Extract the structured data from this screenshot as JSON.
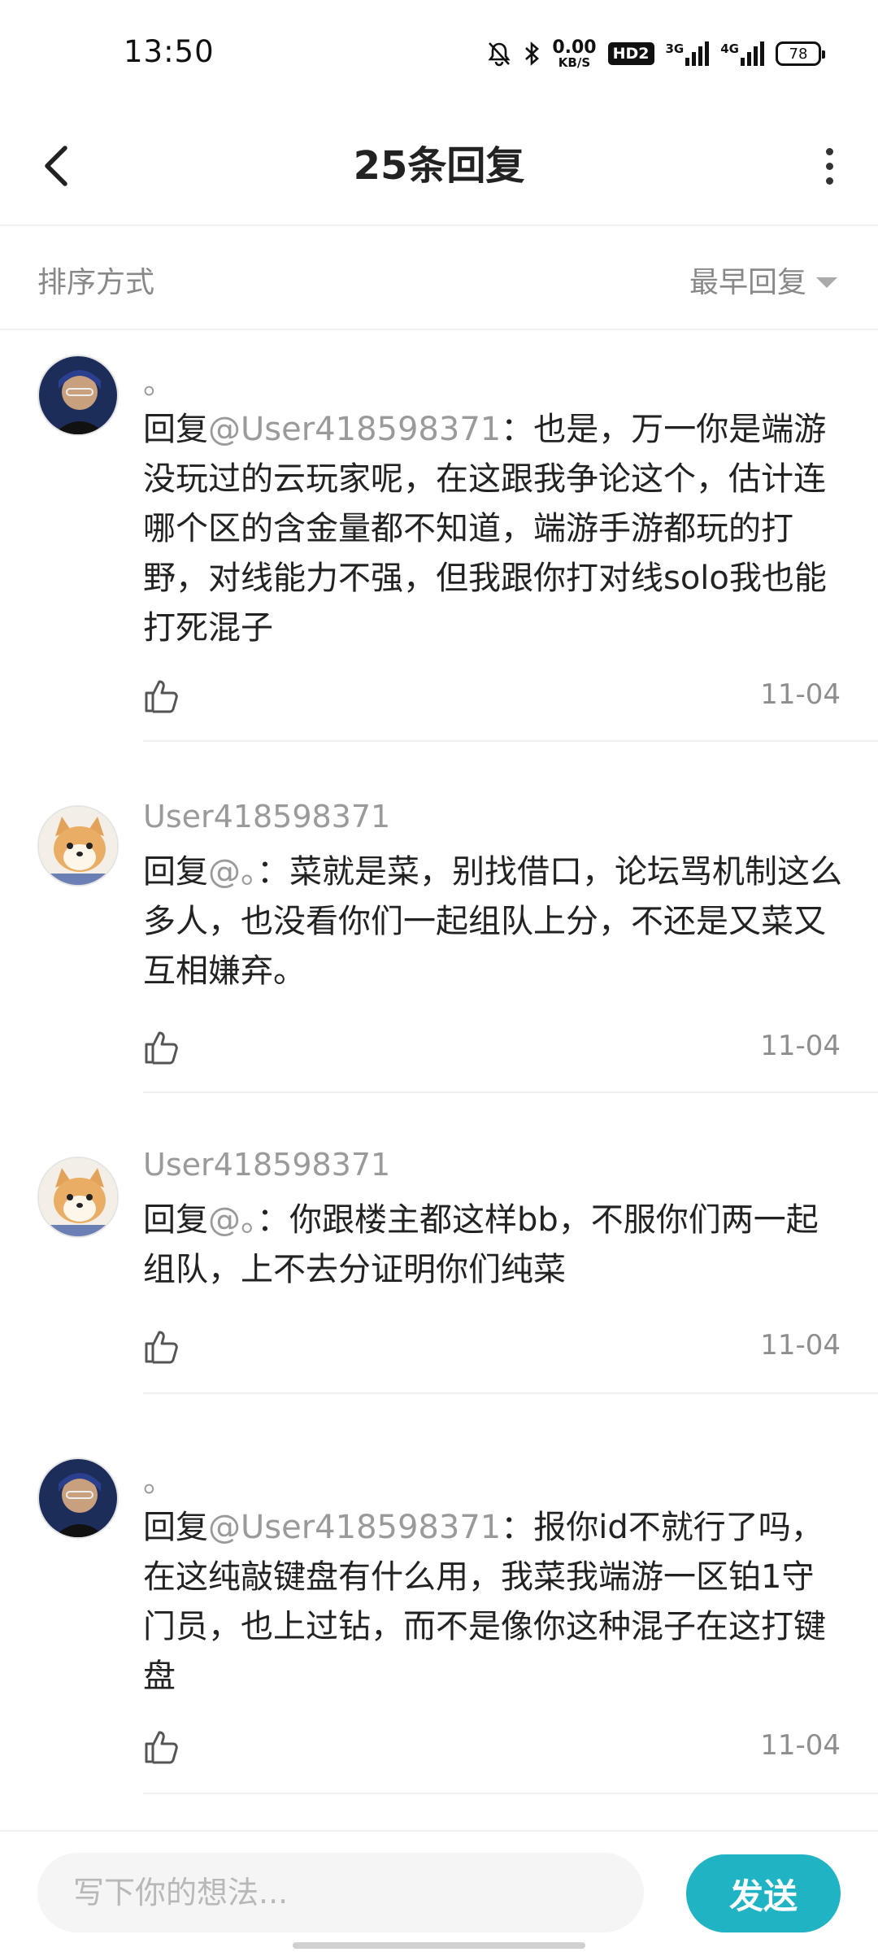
{
  "status_bar": {
    "time": "13:50",
    "net_speed_value": "0.00",
    "net_speed_unit": "KB/S",
    "hd_badge": "HD2",
    "sim1_type": "3G",
    "sim2_type": "4G",
    "battery": "78"
  },
  "header": {
    "title": "25条回复"
  },
  "sort": {
    "label": "排序方式",
    "value": "最早回复"
  },
  "comments": [
    {
      "username": "。",
      "reply_prefix": "回复",
      "mention": "@User418598371",
      "text": "：也是，万一你是端游没玩过的云玩家呢，在这跟我争论这个，估计连哪个区的含金量都不知道，端游手游都玩的打野，对线能力不强，但我跟你打对线solo我也能打死混子",
      "date": "11-04"
    },
    {
      "username": "User418598371",
      "reply_prefix": "回复",
      "mention": "@。",
      "text": "：菜就是菜，别找借口，论坛骂机制这么多人，也没看你们一起组队上分，不还是又菜又互相嫌弃。",
      "date": "11-04"
    },
    {
      "username": "User418598371",
      "reply_prefix": "回复",
      "mention": "@。",
      "text": "：你跟楼主都这样bb，不服你们两一起组队，上不去分证明你们纯菜",
      "date": "11-04"
    },
    {
      "username": "。",
      "reply_prefix": "回复",
      "mention": "@User418598371",
      "text": "：报你id不就行了吗，在这纯敲键盘有什么用，我菜我端游一区铂1守门员，也上过钻，而不是像你这种混子在这打键盘",
      "date": "11-04"
    }
  ],
  "input": {
    "placeholder": "写下你的想法..."
  },
  "send_label": "发送",
  "colors": {
    "accent": "#1fb3c3",
    "muted_text": "#9a9a9a"
  }
}
